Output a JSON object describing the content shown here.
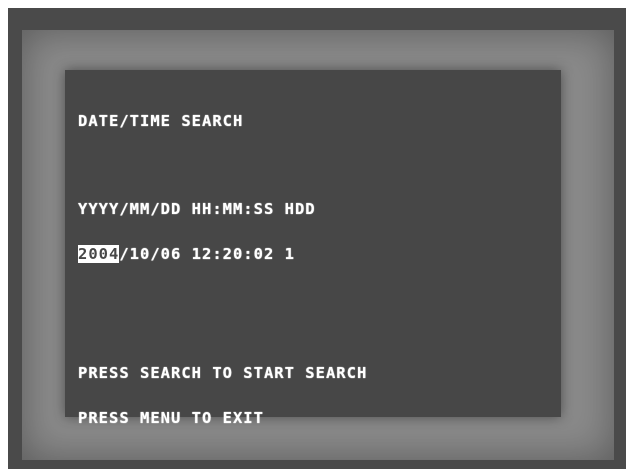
{
  "osd": {
    "title": "DATE/TIME SEARCH",
    "format_header": "YYYY/MM/DD HH:MM:SS HDD",
    "datetime": {
      "year": "2004",
      "rest": "/10/06 12:20:02 1"
    },
    "instructions": [
      "PRESS SEARCH TO START SEARCH",
      "PRESS MENU TO EXIT"
    ]
  },
  "colors": {
    "screen_bg": "#474747",
    "bezel": "#8a8a8a",
    "text": "#ffffff"
  }
}
